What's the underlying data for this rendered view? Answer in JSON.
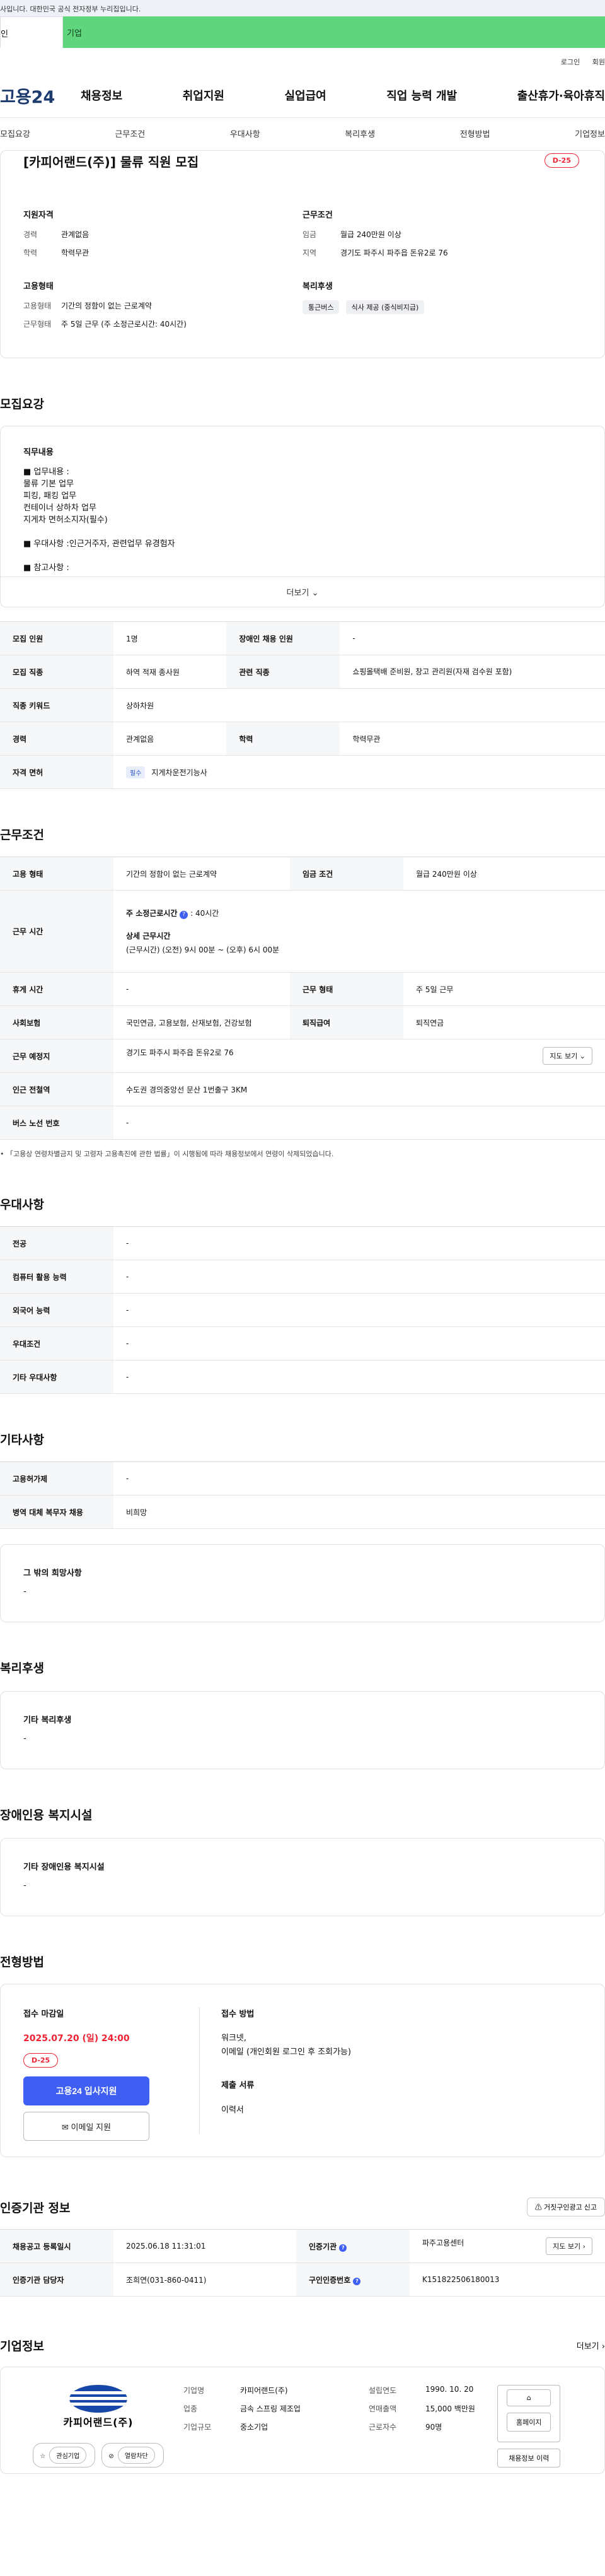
{
  "top_notice": "사입니다. 대한민국 공식 전자정부 누리집입니다.",
  "site_tabs": [
    "인",
    "기업"
  ],
  "util_links": [
    "로그인",
    "회원"
  ],
  "logo": "고용24",
  "gnb": [
    "채용정보",
    "취업지원",
    "실업급여",
    "직업 능력 개발",
    "출산휴가·육아휴직"
  ],
  "subnav": [
    "모집요강",
    "근무조건",
    "우대사항",
    "복리후생",
    "전형방법",
    "기업정보"
  ],
  "job": {
    "title": "[카피어랜드(주)] 물류 직원 모집",
    "dday": "D-25",
    "qual_title": "지원자격",
    "qual": [
      {
        "k": "경력",
        "v": "관계없음"
      },
      {
        "k": "학력",
        "v": "학력무관"
      }
    ],
    "cond_title": "근무조건",
    "cond": [
      {
        "k": "임금",
        "v": "월급 240만원 이상"
      },
      {
        "k": "지역",
        "v": "경기도 파주시 파주읍 돈유2로 76"
      }
    ],
    "emp_title": "고용형태",
    "emp": [
      {
        "k": "고용형태",
        "v": "기간의 정함이 없는 근로계약"
      },
      {
        "k": "근무형태",
        "v": "주 5일 근무 (주 소정근로시간: 40시간)"
      }
    ],
    "welfare_title": "복리후생",
    "welfare_chips": [
      "통근버스",
      "식사 제공 (중식비지급)"
    ]
  },
  "recruit": {
    "title": "모집요강",
    "duty_title": "직무내용",
    "duty_lines": [
      "■ 업무내용 :",
      "물류 기본 업무",
      "피킹, 패킹 업무",
      "컨테이너 상하차 업무",
      "지게차 면허소지자(필수)",
      "",
      "■ 우대사항 :인근거주자, 관련업무 유경험자",
      "",
      "■ 참고사항 :"
    ],
    "more": "더보기",
    "rows": [
      {
        "k1": "모집 인원",
        "v1": "1명",
        "k2": "장애인 채용 인원",
        "v2": "-"
      },
      {
        "k1": "모집 직종",
        "v1": "하역 적재 종사원",
        "k2": "관련 직종",
        "v2": "쇼핑몰택배 준비원, 창고 관리원(자재 검수원 포함)"
      },
      {
        "k1": "직종 키워드",
        "v1": "상하차원",
        "k2": "",
        "v2": ""
      },
      {
        "k1": "경력",
        "v1": "관계없음",
        "k2": "학력",
        "v2": "학력무관"
      },
      {
        "k1": "자격 면허",
        "v1": "지게차운전기능사",
        "k2": "",
        "v2": ""
      }
    ],
    "required_tag": "필수"
  },
  "work": {
    "title": "근무조건",
    "emp_type_k": "고용 형태",
    "emp_type_v": "기간의 정함이 없는 근로계약",
    "wage_k": "임금 조건",
    "wage_v": "월급 240만원 이상",
    "hours_k": "근무 시간",
    "weekly_label": "주 소정근로시간",
    "weekly_v": ": 40시간",
    "detail_label": "상세 근무시간",
    "detail_v": "(근무시간) (오전) 9시 00분 ~ (오후) 6시 00분",
    "break_k": "휴게 시간",
    "break_v": "-",
    "shift_k": "근무 형태",
    "shift_v": "주 5일 근무",
    "ins_k": "사회보험",
    "ins_v": "국민연금, 고용보험, 산재보험, 건강보험",
    "sev_k": "퇴직급여",
    "sev_v": "퇴직연금",
    "place_k": "근무 예정지",
    "place_v": "경기도 파주시 파주읍 돈유2로 76",
    "map_btn": "지도 보기",
    "station_k": "인근 전철역",
    "station_v": "수도권 경의중앙선 문산 1번출구 3KM",
    "bus_k": "버스 노선 번호",
    "bus_v": "-",
    "note": "「고용상 연령차별금지 및 고령자 고용촉진에 관한 법률」이 시행됨에 따라 채용정보에서 연령이 삭제되었습니다."
  },
  "pref": {
    "title": "우대사항",
    "rows": [
      {
        "k": "전공",
        "v": "-"
      },
      {
        "k": "컴퓨터 활용 능력",
        "v": "-"
      },
      {
        "k": "외국어 능력",
        "v": "-"
      },
      {
        "k": "우대조건",
        "v": "-"
      },
      {
        "k": "기타 우대사항",
        "v": "-"
      }
    ]
  },
  "etc": {
    "title": "기타사항",
    "rows": [
      {
        "k": "고용허가제",
        "v": "-"
      },
      {
        "k": "병역 대체 복무자 채용",
        "v": "비희망"
      }
    ],
    "box_title": "그 밖의 희망사항",
    "box_value": "-"
  },
  "benefit": {
    "title": "복리후생",
    "box_title": "기타 복리후생",
    "box_value": "-"
  },
  "disabled": {
    "title": "장애인용 복지시설",
    "box_title": "기타 장애인용 복지시설",
    "box_value": "-"
  },
  "method": {
    "title": "전형방법",
    "deadline_label": "접수 마감일",
    "deadline": "2025.07.20 (일) 24:00",
    "dday": "D-25",
    "apply_btn": "고용24 입사지원",
    "email_btn": "이메일 지원",
    "way_label": "접수 방법",
    "way_lines": [
      "워크넷,",
      "이메일 (개인회원 로그인 후 조회가능)"
    ],
    "docs_label": "제출 서류",
    "docs": "이력서"
  },
  "agency": {
    "title": "인증기관 정보",
    "report_btn": "거짓구인광고 신고",
    "r1k1": "채용공고 등록일시",
    "r1v1": "2025.06.18 11:31:01",
    "r1k2": "인증기관",
    "r1v2": "파주고용센터",
    "map_btn": "지도 보기",
    "r2k1": "인증기관 담당자",
    "r2v1": "조희연(031-860-0411)",
    "r2k2": "구인인증번호",
    "r2v2": "K151822506180013"
  },
  "company": {
    "title": "기업정보",
    "more": "더보기",
    "logo_text": "카피어랜드(주)",
    "fav_btn": "관심기업",
    "block_btn": "열람차단",
    "c1": [
      {
        "k": "기업명",
        "v": "카피어랜드(주)"
      },
      {
        "k": "업종",
        "v": "금속 스프링 제조업"
      },
      {
        "k": "기업규모",
        "v": "중소기업"
      }
    ],
    "c2": [
      {
        "k": "설립연도",
        "v": "1990. 10. 20"
      },
      {
        "k": "연매출액",
        "v": "15,000 백만원"
      },
      {
        "k": "근로자수",
        "v": "90명"
      }
    ],
    "homepage_btn": "홈페이지",
    "history_btn": "채용정보 이력"
  }
}
